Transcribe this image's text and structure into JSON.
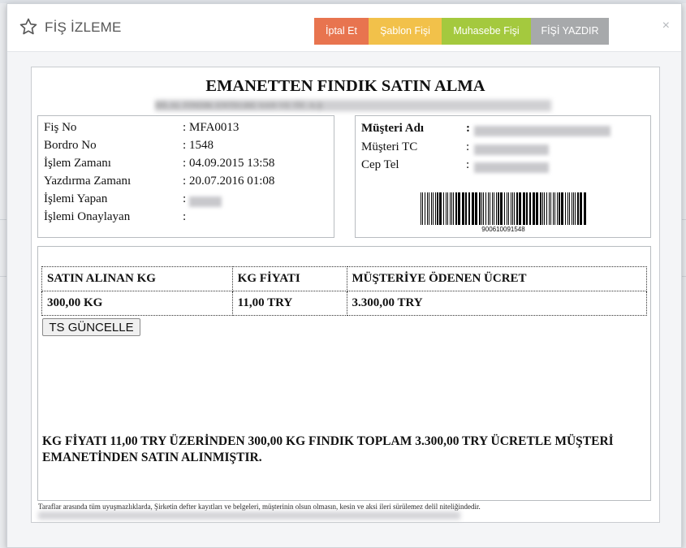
{
  "modal": {
    "title": "FİŞ İZLEME",
    "buttons": {
      "cancel": "İptal Et",
      "template": "Şablon Fişi",
      "accounting": "Muhasebe Fişi",
      "print": "FİŞİ YAZDIR"
    },
    "close_glyph": "×"
  },
  "receipt": {
    "title": "EMANETTEN FINDIK SATIN ALMA",
    "subtitle_redacted": "BİLAL FINDIK ENTEGRE SAN VE TİC A.Ş",
    "info": {
      "separator": ":",
      "rows": [
        {
          "label": "Fiş No",
          "value": "MFA0013"
        },
        {
          "label": "Bordro No",
          "value": "1548"
        },
        {
          "label": "İşlem Zamanı",
          "value": "04.09.2015 13:58"
        },
        {
          "label": "Yazdırma Zamanı",
          "value": "20.07.2016 01:08"
        },
        {
          "label": "İşlemi Yapan",
          "value": ""
        },
        {
          "label": "İşlemi Onaylayan",
          "value": ""
        }
      ]
    },
    "customer": {
      "name_label": "Müşteri Adı",
      "tc_label": "Müşteri TC",
      "phone_label": "Cep Tel",
      "separator": ":",
      "barcode_number": "900610091548"
    },
    "table": {
      "headers": [
        "SATIN ALINAN KG",
        "KG FİYATI",
        "MÜŞTERİYE ÖDENEN ÜCRET"
      ],
      "row": [
        "300,00 KG",
        "11,00 TRY",
        "3.300,00 TRY"
      ]
    },
    "ts_button": "TS GÜNCELLE",
    "summary": "KG FİYATI 11,00 TRY ÜZERİNDEN 300,00 KG FINDIK TOPLAM 3.300,00 TRY ÜCRETLE MÜŞTERİ EMANETİNDEN SATIN ALINMIŞTIR.",
    "footnote": "Taraflar arasında tüm uyuşmazlıklarda, Şirketin defter kayıtları ve belgeleri, müşterinin olsun olmasın, kesin ve aksi ileri sürülemez delil niteliğindedir."
  },
  "colors": {
    "cancel": "#e8744f",
    "template": "#f2c14a",
    "accounting": "#a4c93e",
    "print": "#a7a9ab"
  }
}
